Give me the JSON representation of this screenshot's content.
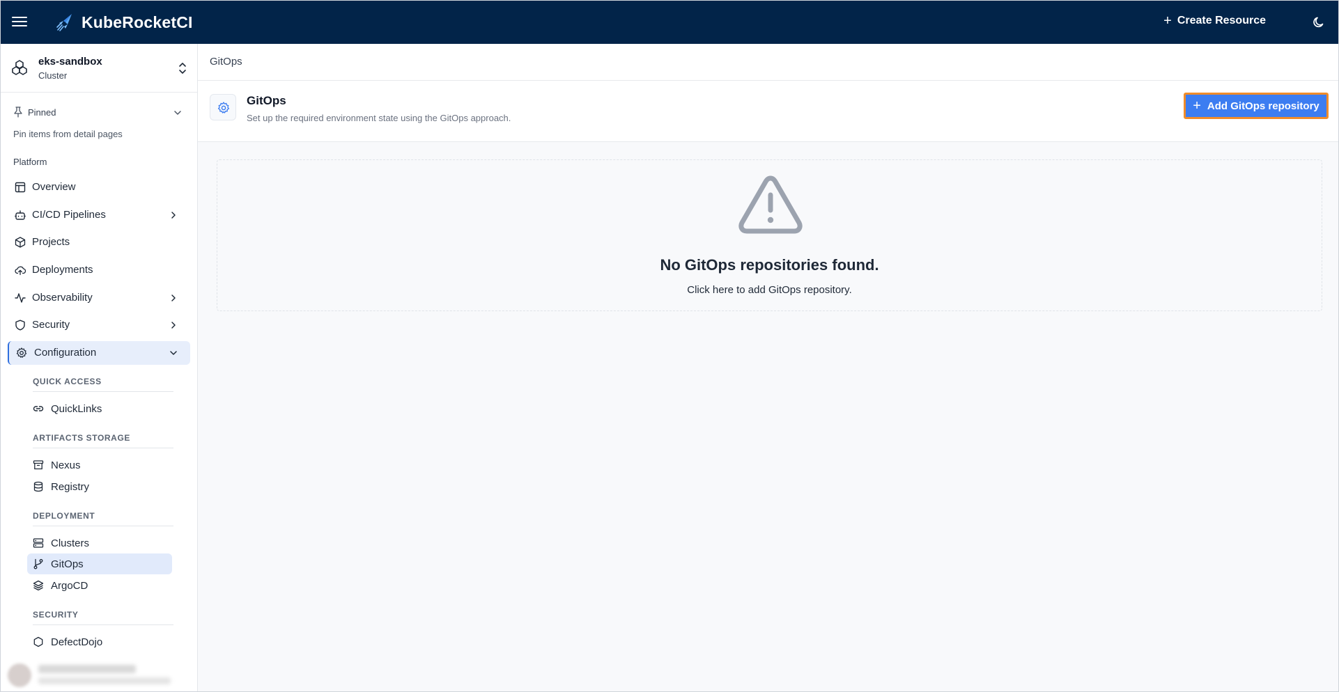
{
  "app": {
    "name": "KubeRocketCI",
    "create_resource_label": "Create Resource"
  },
  "cluster": {
    "name": "eks-sandbox",
    "type": "Cluster"
  },
  "sidebar": {
    "pinned_label": "Pinned",
    "pinned_hint": "Pin items from detail pages",
    "section_platform": "Platform",
    "items": [
      {
        "label": "Overview",
        "icon": "layout-icon"
      },
      {
        "label": "CI/CD Pipelines",
        "icon": "bot-icon"
      },
      {
        "label": "Projects",
        "icon": "box-icon"
      },
      {
        "label": "Deployments",
        "icon": "cloud-upload-icon"
      },
      {
        "label": "Observability",
        "icon": "activity-icon"
      },
      {
        "label": "Security",
        "icon": "shield-icon"
      },
      {
        "label": "Configuration",
        "icon": "gear-icon"
      }
    ],
    "config_groups": {
      "quick_access": {
        "header": "QUICK ACCESS",
        "items": [
          "QuickLinks"
        ]
      },
      "artifacts_storage": {
        "header": "ARTIFACTS STORAGE",
        "items": [
          "Nexus",
          "Registry"
        ]
      },
      "deployment": {
        "header": "DEPLOYMENT",
        "items": [
          "Clusters",
          "GitOps",
          "ArgoCD"
        ]
      },
      "security": {
        "header": "SECURITY",
        "items": [
          "DefectDojo"
        ]
      }
    }
  },
  "breadcrumb": "GitOps",
  "page": {
    "title": "GitOps",
    "description": "Set up the required environment state using the GitOps approach.",
    "add_button_label": "Add GitOps repository"
  },
  "empty_state": {
    "title": "No GitOps repositories found.",
    "subtitle": "Click here to add GitOps repository."
  },
  "colors": {
    "topbar": "#022449",
    "accent": "#3c7df1",
    "highlight_border": "#f08c2a"
  }
}
